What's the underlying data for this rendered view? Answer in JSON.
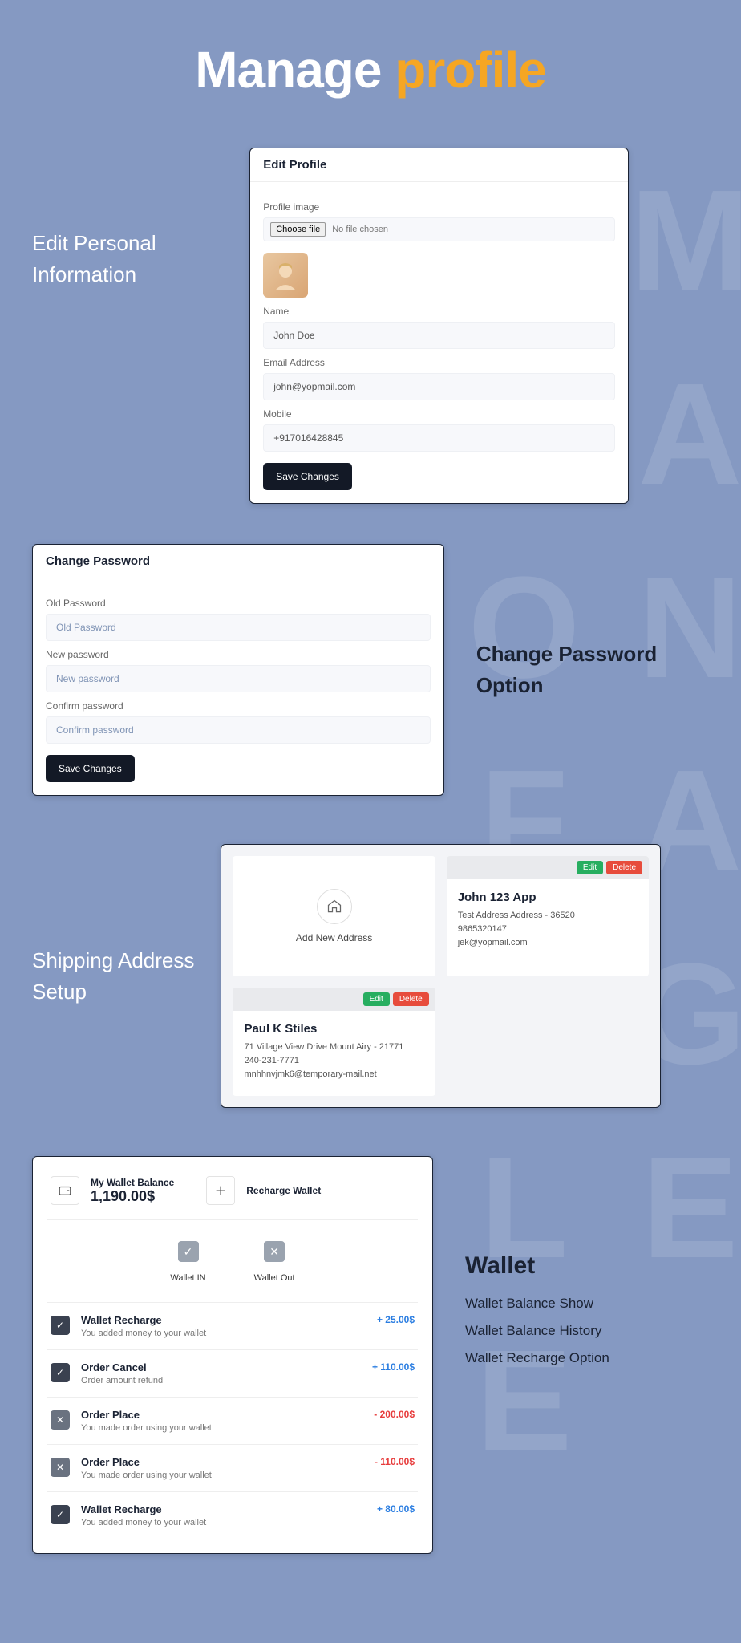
{
  "pageTitle": {
    "part1": "Manage",
    "part2": "profile"
  },
  "watermark": "MANAGE PROFILE",
  "sections": {
    "editProfile": {
      "label": "Edit Personal Information",
      "cardTitle": "Edit Profile",
      "profileImageLabel": "Profile image",
      "chooseFile": "Choose file",
      "noFileChosen": "No file chosen",
      "nameLabel": "Name",
      "nameValue": "John Doe",
      "emailLabel": "Email Address",
      "emailValue": "john@yopmail.com",
      "mobileLabel": "Mobile",
      "mobileValue": "+917016428845",
      "saveBtn": "Save Changes"
    },
    "changePassword": {
      "label": "Change Password Option",
      "cardTitle": "Change Password",
      "oldLabel": "Old Password",
      "oldPlaceholder": "Old Password",
      "newLabel": "New password",
      "newPlaceholder": "New password",
      "confirmLabel": "Confirm password",
      "confirmPlaceholder": "Confirm password",
      "saveBtn": "Save Changes"
    },
    "shipping": {
      "label": "Shipping Address Setup",
      "addNew": "Add New Address",
      "edit": "Edit",
      "delete": "Delete",
      "addresses": [
        {
          "name": "John 123 App",
          "line1": "Test Address Address - 36520",
          "phone": "9865320147",
          "email": "jek@yopmail.com"
        },
        {
          "name": "Paul K Stiles",
          "line1": "71 Village View Drive Mount Airy - 21771",
          "phone": "240-231-7771",
          "email": "mnhhnvjmk6@temporary-mail.net"
        }
      ]
    },
    "wallet": {
      "heading": "Wallet",
      "features": [
        "Wallet Balance Show",
        "Wallet Balance History",
        "Wallet Recharge Option"
      ],
      "balanceLabel": "My Wallet Balance",
      "balanceValue": "1,190.00$",
      "rechargeLabel": "Recharge Wallet",
      "filters": {
        "in": "Wallet IN",
        "out": "Wallet Out"
      },
      "transactions": [
        {
          "title": "Wallet Recharge",
          "desc": "You added money to your wallet",
          "amount": "+ 25.00$",
          "type": "pos",
          "icon": "check"
        },
        {
          "title": "Order Cancel",
          "desc": "Order amount refund",
          "amount": "+ 110.00$",
          "type": "pos",
          "icon": "check"
        },
        {
          "title": "Order Place",
          "desc": "You made order using your wallet",
          "amount": "- 200.00$",
          "type": "neg",
          "icon": "x"
        },
        {
          "title": "Order Place",
          "desc": "You made order using your wallet",
          "amount": "- 110.00$",
          "type": "neg",
          "icon": "x"
        },
        {
          "title": "Wallet Recharge",
          "desc": "You added money to your wallet",
          "amount": "+ 80.00$",
          "type": "pos",
          "icon": "check"
        }
      ]
    }
  }
}
